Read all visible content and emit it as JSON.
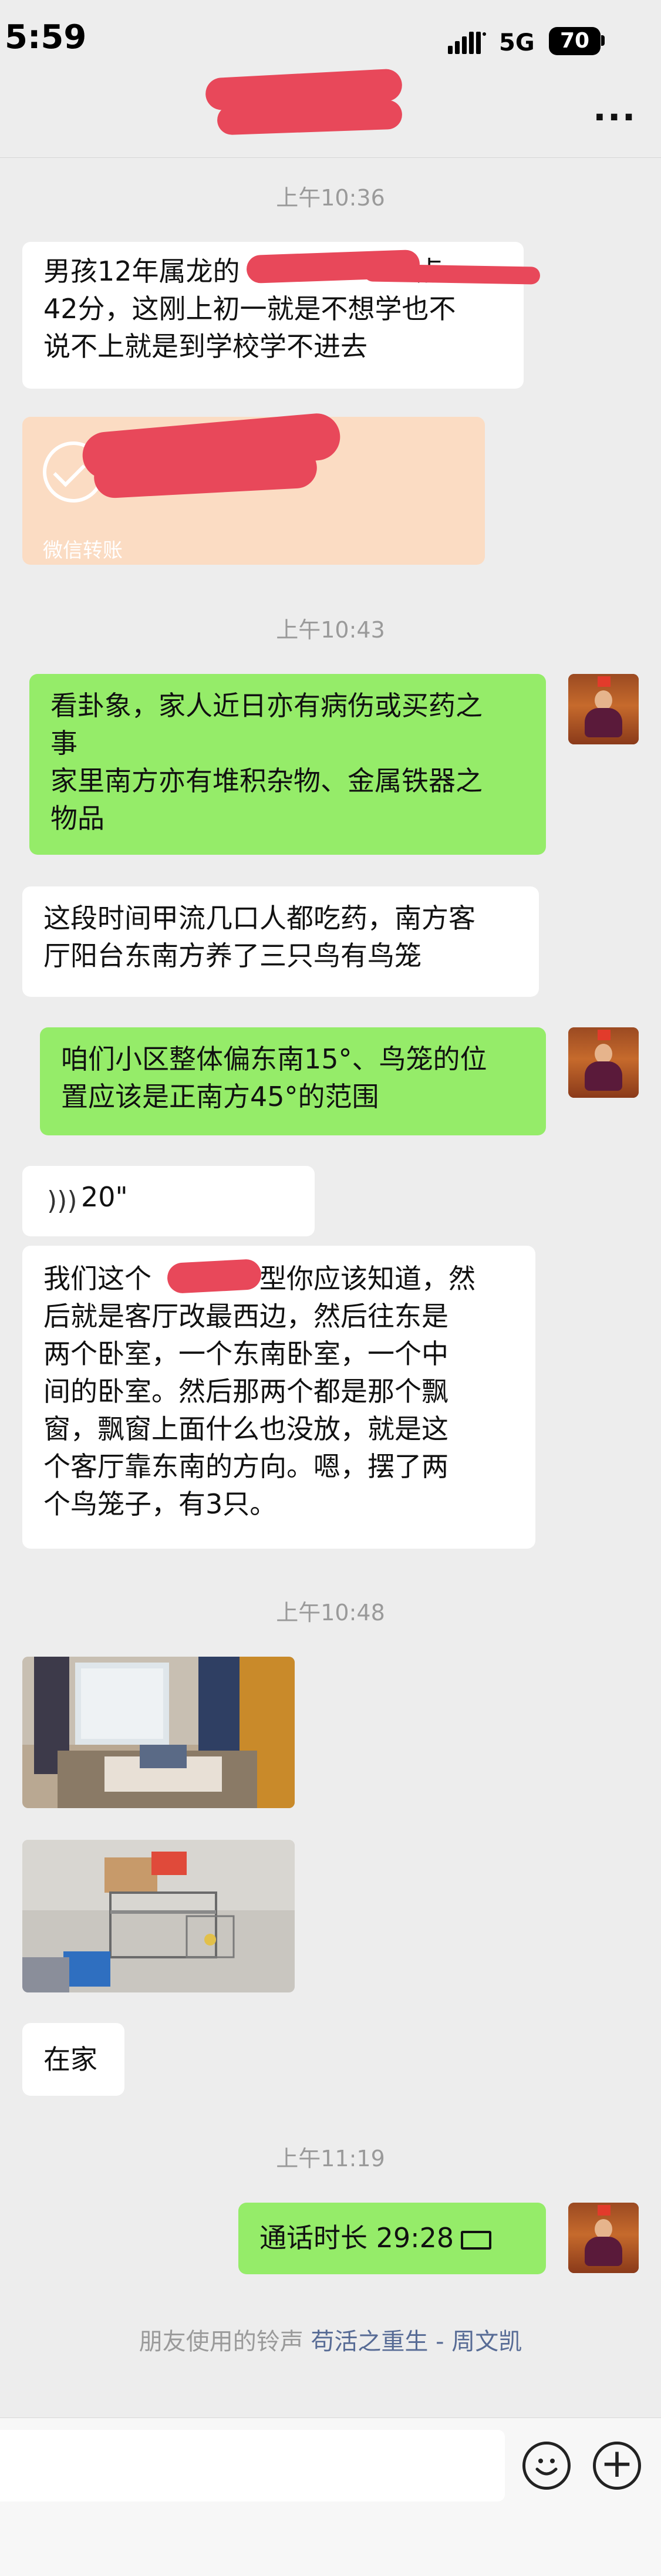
{
  "status_bar": {
    "time": "5:59",
    "network": "5G",
    "battery": "70"
  },
  "header": {
    "more_label": "···"
  },
  "timestamps": [
    "上午10:36",
    "上午10:43",
    "上午10:48",
    "上午11:19"
  ],
  "messages": {
    "m1": {
      "line1": "男孩12年属龙的",
      "line1_tail": "点",
      "line2": "42分，这刚上初一就是不想学也不",
      "line3": "说不上就是到学校学不进去"
    },
    "transfer": {
      "label": "微信转账"
    },
    "m2": {
      "line1": "看卦象，家人近日亦有病伤或买药之",
      "line2": "事",
      "line3": "家里南方亦有堆积杂物、金属铁器之",
      "line4": "物品"
    },
    "m3": {
      "line1": "这段时间甲流几口人都吃药，南方客",
      "line2": "厅阳台东南方养了三只鸟有鸟笼"
    },
    "m4": {
      "line1": "咱们小区整体偏东南15°、鸟笼的位",
      "line2": "置应该是正南方45°的范围"
    },
    "voice": {
      "length": "20\""
    },
    "m5": {
      "line1a": "我们这个",
      "line1b": "户型你应该知道，然",
      "line2": "后就是客厅改最西边，然后往东是",
      "line3": "两个卧室，一个东南卧室，一个中",
      "line4": "间的卧室。然后那两个都是那个飘",
      "line5": "窗，飘窗上面什么也没放，就是这",
      "line6": "个客厅靠东南的方向。嗯，摆了两",
      "line7": "个鸟笼子，有3只。"
    },
    "m6": {
      "text": "在家"
    },
    "call": {
      "text": "通话时长 29:28"
    }
  },
  "ringtone": {
    "prefix": "朋友使用的铃声",
    "song": "苟活之重生 - 周文凯"
  },
  "colors": {
    "background": "#ededed",
    "right_bubble": "#95ec69",
    "left_bubble": "#ffffff",
    "redaction": "#e8485a",
    "link": "#576b95"
  }
}
